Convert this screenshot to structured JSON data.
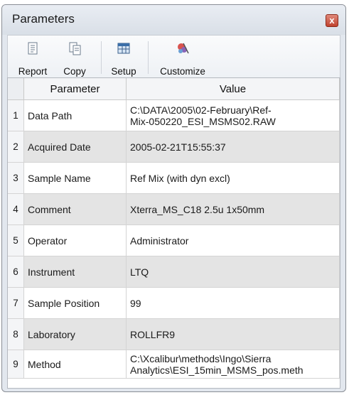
{
  "window": {
    "title": "Parameters",
    "close_glyph": "x"
  },
  "toolbar": {
    "buttons": [
      {
        "label": "Report",
        "icon": "report-icon"
      },
      {
        "label": "Copy",
        "icon": "copy-icon"
      },
      {
        "label": "Setup",
        "icon": "setup-icon"
      },
      {
        "label": "Customize",
        "icon": "customize-icon"
      }
    ]
  },
  "table": {
    "columns": [
      "Parameter",
      "Value"
    ],
    "rows": [
      {
        "num": "1",
        "parameter": "Data Path",
        "value_line1": "C:\\DATA\\2005\\02-February\\Ref-",
        "value_line2": "Mix-050220_ESI_MSMS02.RAW"
      },
      {
        "num": "2",
        "parameter": "Acquired Date",
        "value_line1": "2005-02-21T15:55:37",
        "value_line2": ""
      },
      {
        "num": "3",
        "parameter": "Sample Name",
        "value_line1": "Ref Mix (with dyn excl)",
        "value_line2": ""
      },
      {
        "num": "4",
        "parameter": "Comment",
        "value_line1": "Xterra_MS_C18 2.5u 1x50mm",
        "value_line2": ""
      },
      {
        "num": "5",
        "parameter": "Operator",
        "value_line1": "Administrator",
        "value_line2": ""
      },
      {
        "num": "6",
        "parameter": "Instrument",
        "value_line1": "LTQ",
        "value_line2": ""
      },
      {
        "num": "7",
        "parameter": "Sample Position",
        "value_line1": "99",
        "value_line2": ""
      },
      {
        "num": "8",
        "parameter": "Laboratory",
        "value_line1": "ROLLFR9",
        "value_line2": ""
      },
      {
        "num": "9",
        "parameter": "Method",
        "value_line1": "C:\\Xcalibur\\methods\\Ingo\\Sierra",
        "value_line2": "Analytics\\ESI_15min_MSMS_pos.meth"
      }
    ]
  }
}
